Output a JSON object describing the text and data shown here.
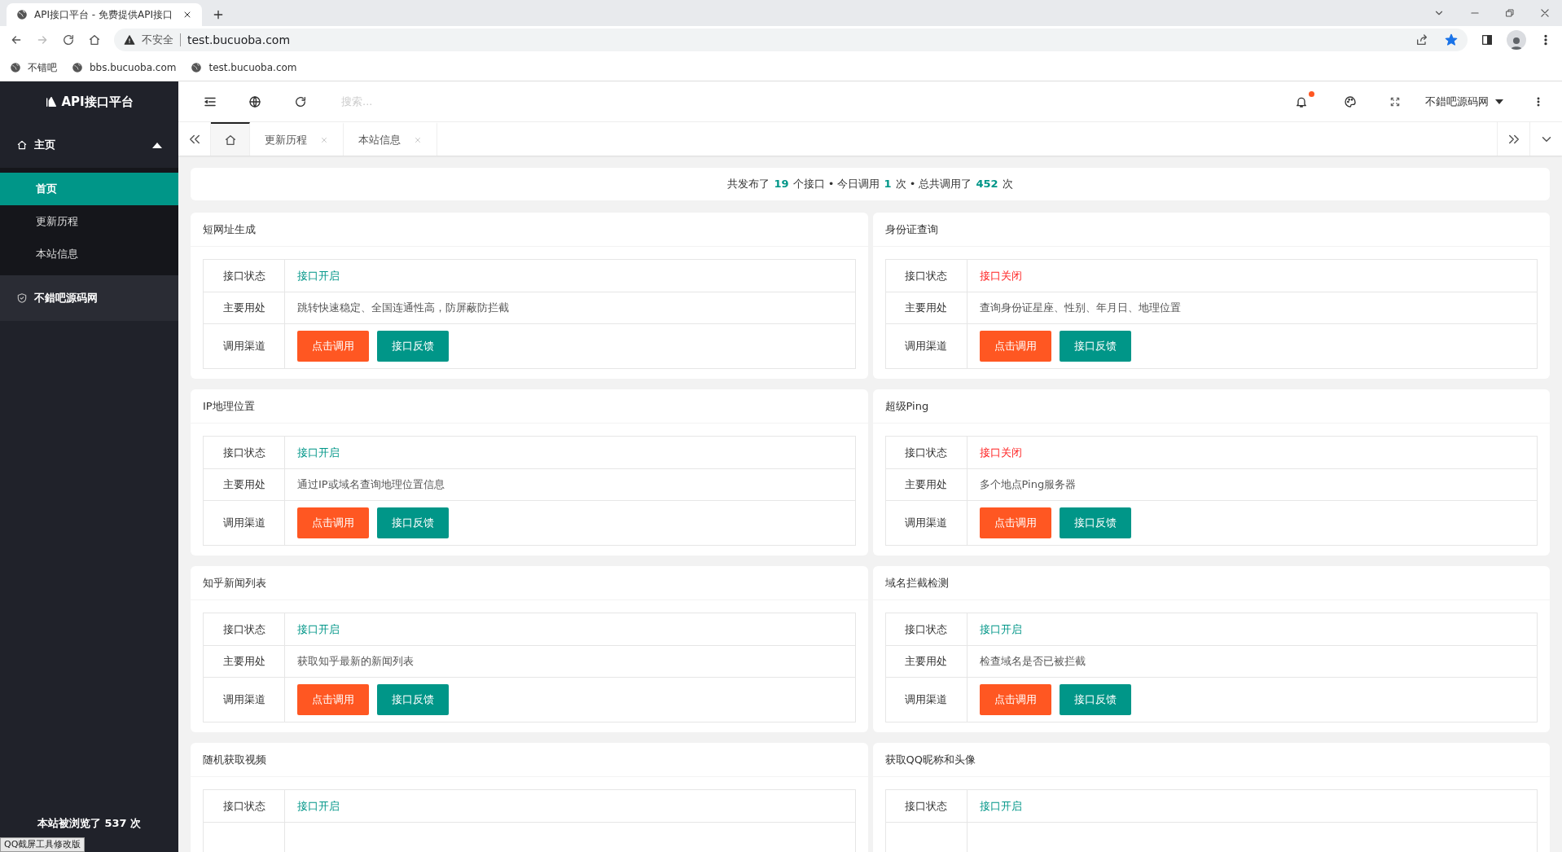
{
  "browser": {
    "tab_title": "API接口平台 - 免费提供API接口",
    "security_label": "不安全",
    "url": "test.bucuoba.com",
    "bookmarks": [
      "不错吧",
      "bbs.bucuoba.com",
      "test.bucuoba.com"
    ]
  },
  "sidebar": {
    "logo": "API接口平台",
    "menu": [
      {
        "label": "主页",
        "expanded": true,
        "children": [
          {
            "label": "首页",
            "selected": true
          },
          {
            "label": "更新历程",
            "selected": false
          },
          {
            "label": "本站信息",
            "selected": false
          }
        ]
      },
      {
        "label": "不錯吧源码网"
      }
    ],
    "footer": "本站被浏览了 537 次"
  },
  "header": {
    "search_placeholder": "搜索...",
    "notification_dot": true,
    "user": "不錯吧源码网"
  },
  "tabs": [
    {
      "kind": "home",
      "selected": true
    },
    {
      "label": "更新历程",
      "selected": false
    },
    {
      "label": "本站信息",
      "selected": false
    }
  ],
  "stats": "共发布了 **19** 个接口 • 今日调用 **1** 次 • 总共调用了 **452** 次",
  "cards": [
    {
      "title": "短网址生成",
      "status_label": "接口状态",
      "status": "接口开启",
      "open": true,
      "usage_label": "主要用处",
      "usage": "跳转快速稳定、全国连通性高，防屏蔽防拦截",
      "channel_label": "调用渠道",
      "buttons": [
        "点击调用",
        "接口反馈"
      ]
    },
    {
      "title": "身份证查询",
      "status_label": "接口状态",
      "status": "接口关闭",
      "open": false,
      "usage_label": "主要用处",
      "usage": "查询身份证星座、性别、年月日、地理位置",
      "channel_label": "调用渠道",
      "buttons": [
        "点击调用",
        "接口反馈"
      ]
    },
    {
      "title": "IP地理位置",
      "status_label": "接口状态",
      "status": "接口开启",
      "open": true,
      "usage_label": "主要用处",
      "usage": "通过IP或域名查询地理位置信息",
      "channel_label": "调用渠道",
      "buttons": [
        "点击调用",
        "接口反馈"
      ]
    },
    {
      "title": "超级Ping",
      "status_label": "接口状态",
      "status": "接口关闭",
      "open": false,
      "usage_label": "主要用处",
      "usage": "多个地点Ping服务器",
      "channel_label": "调用渠道",
      "buttons": [
        "点击调用",
        "接口反馈"
      ]
    },
    {
      "title": "知乎新闻列表",
      "status_label": "接口状态",
      "status": "接口开启",
      "open": true,
      "usage_label": "主要用处",
      "usage": "获取知乎最新的新闻列表",
      "channel_label": "调用渠道",
      "buttons": [
        "点击调用",
        "接口反馈"
      ]
    },
    {
      "title": "域名拦截检测",
      "status_label": "接口状态",
      "status": "接口开启",
      "open": true,
      "usage_label": "主要用处",
      "usage": "检查域名是否已被拦截",
      "channel_label": "调用渠道",
      "buttons": [
        "点击调用",
        "接口反馈"
      ]
    },
    {
      "title": "随机获取视频",
      "status_label": "接口状态",
      "status": "接口开启",
      "open": true
    },
    {
      "title": "获取QQ昵称和头像",
      "status_label": "接口状态",
      "status": "接口开启",
      "open": true
    }
  ],
  "overlay_label": "QQ截屏工具修改版"
}
